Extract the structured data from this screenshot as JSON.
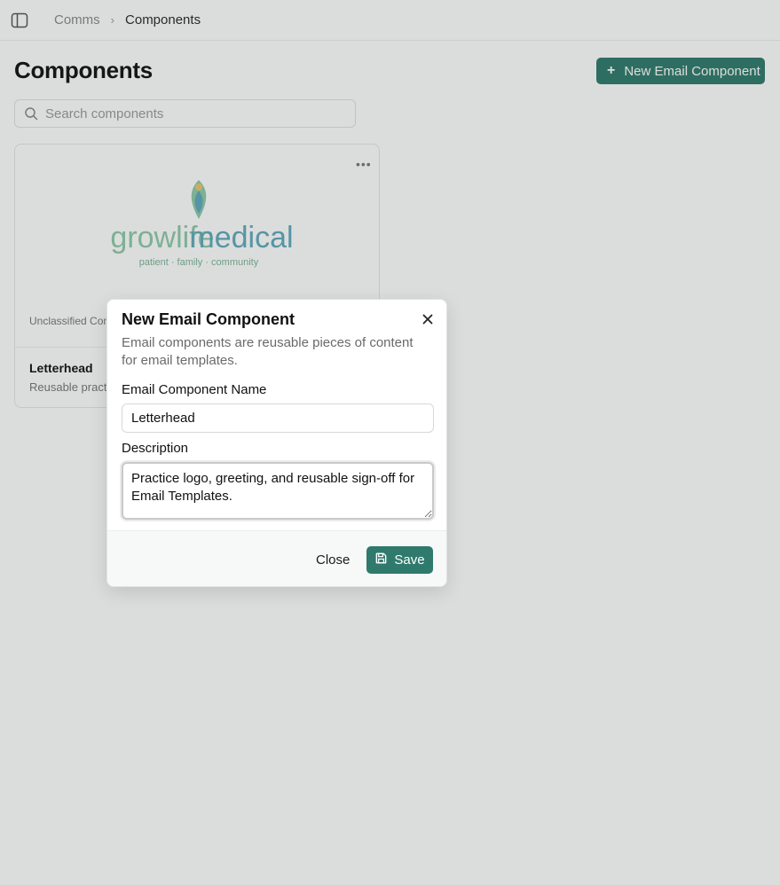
{
  "breadcrumb": {
    "root": "Comms",
    "current": "Components"
  },
  "page": {
    "title": "Components",
    "new_button_label": "New Email Component"
  },
  "search": {
    "placeholder": "Search components"
  },
  "component_card": {
    "logo_brand_left": "growlife",
    "logo_brand_right": "medical",
    "logo_tagline": "patient · family · community",
    "preview_caption": "Unclassified Component",
    "title": "Letterhead",
    "description": "Reusable practice logo, greeting and sign-off"
  },
  "dialog": {
    "title": "New Email Component",
    "description": "Email components are reusable pieces of content for email templates.",
    "name_label": "Email Component Name",
    "name_value": "Letterhead",
    "description_label": "Description",
    "description_value": "Practice logo, greeting, and reusable sign-off for Email Templates.",
    "close_label": "Close",
    "save_label": "Save"
  },
  "colors": {
    "accent": "#2f7a6d",
    "logo_green": "#8fc9a9",
    "logo_blue": "#5fa9bd"
  },
  "icons": [
    "sidebar-toggle-icon",
    "chevron-right-icon",
    "plus-icon",
    "search-icon",
    "more-horizontal-icon",
    "close-icon",
    "save-icon"
  ]
}
